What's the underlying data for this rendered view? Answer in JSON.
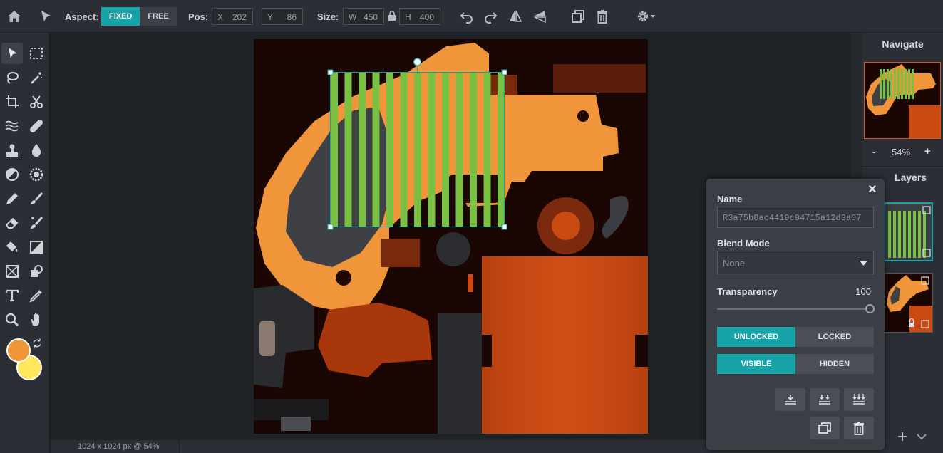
{
  "topbar": {
    "aspect_label": "Aspect:",
    "aspect_options": [
      "FIXED",
      "FREE"
    ],
    "aspect_selected": "FIXED",
    "pos_label": "Pos:",
    "pos_x_label": "X",
    "pos_x": "202",
    "pos_y_label": "Y",
    "pos_y": "86",
    "size_label": "Size:",
    "size_w_label": "W",
    "size_w": "450",
    "size_h_label": "H",
    "size_h": "400"
  },
  "colors": {
    "accent": "#17a3a7",
    "primary_swatch": "#f0953a",
    "secondary_swatch": "#ffe65a",
    "selection_stripes": "#7ac143",
    "texture_orange": "#f0953a",
    "texture_rust": "#c94a13"
  },
  "icons": {
    "top_left": [
      "home-icon",
      "pointer-icon"
    ],
    "top_actions": [
      "undo-icon",
      "redo-icon",
      "flip-horizontal-icon",
      "flip-vertical-icon",
      "duplicate-icon",
      "delete-icon",
      "settings-icon"
    ],
    "tools": [
      "select-arrow-icon",
      "marquee-icon",
      "lasso-icon",
      "magic-wand-icon",
      "crop-icon",
      "scissors-icon",
      "liquify-icon",
      "bandage-icon",
      "stamp-icon",
      "blur-drop-icon",
      "dodge-icon",
      "sponge-icon",
      "pencil-icon",
      "brush-icon",
      "eraser-icon",
      "color-replace-icon",
      "bucket-icon",
      "gradient-icon",
      "shape-icon",
      "clone-shapes-icon",
      "text-icon",
      "eyedropper-icon",
      "zoom-icon",
      "hand-icon"
    ]
  },
  "status": {
    "text": "1024 x 1024 px @ 54%"
  },
  "navigate": {
    "title": "Navigate",
    "zoom_minus": "-",
    "zoom_value": "54%",
    "zoom_plus": "+"
  },
  "layers": {
    "title": "Layers",
    "add": "+"
  },
  "layer_settings": {
    "name_label": "Name",
    "name_value": "R3a75b8ac4419c94715a12d3a07",
    "blend_label": "Blend Mode",
    "blend_value": "None",
    "transparency_label": "Transparency",
    "transparency_value": "100",
    "transparency_level": 1.0,
    "lock_options": [
      "UNLOCKED",
      "LOCKED"
    ],
    "lock_selected": "UNLOCKED",
    "visibility_options": [
      "VISIBLE",
      "HIDDEN"
    ],
    "visibility_selected": "VISIBLE",
    "close": "×"
  }
}
